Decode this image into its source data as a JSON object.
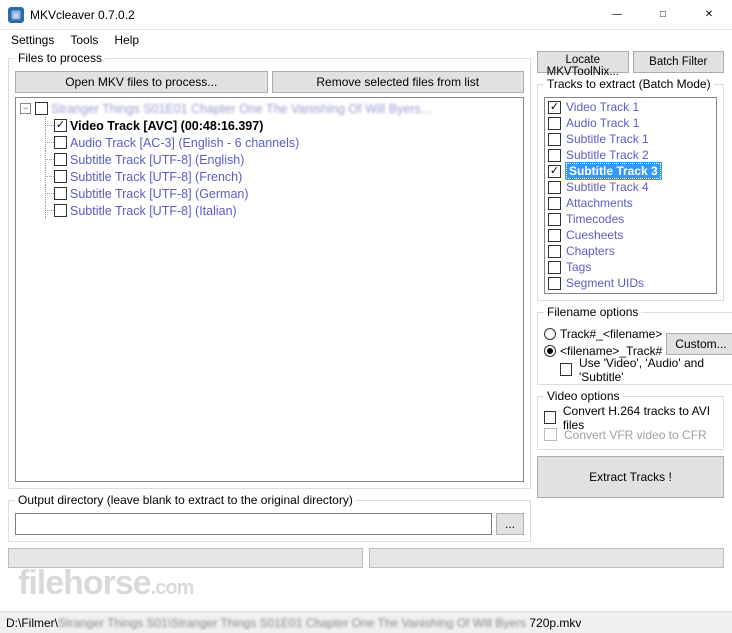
{
  "window": {
    "title": "MKVcleaver 0.7.0.2"
  },
  "menu": {
    "settings": "Settings",
    "tools": "Tools",
    "help": "Help"
  },
  "files_group": {
    "legend": "Files to process",
    "open_btn": "Open MKV files to process...",
    "remove_btn": "Remove selected files from list"
  },
  "tree": {
    "file_title_obscured": "Stranger Things S01E01 Chapter One The Vanishing Of Will Byers...",
    "tracks": [
      {
        "label": "Video Track [AVC] (00:48:16.397)",
        "checked": true,
        "bold": true
      },
      {
        "label": "Audio Track [AC-3] (English - 6 channels)",
        "checked": false,
        "bold": false
      },
      {
        "label": "Subtitle Track [UTF-8] (English)",
        "checked": false,
        "bold": false
      },
      {
        "label": "Subtitle Track [UTF-8] (French)",
        "checked": false,
        "bold": false
      },
      {
        "label": "Subtitle Track [UTF-8] (German)",
        "checked": false,
        "bold": false
      },
      {
        "label": "Subtitle Track [UTF-8] (Italian)",
        "checked": false,
        "bold": false
      }
    ]
  },
  "output_group": {
    "legend": "Output directory (leave blank to extract to the original directory)",
    "value": "",
    "browse": "..."
  },
  "right_top": {
    "locate": "Locate MKVToolNix...",
    "batch_filter": "Batch Filter"
  },
  "tracks_extract": {
    "legend": "Tracks to extract (Batch Mode)",
    "items": [
      {
        "label": "Video Track 1",
        "checked": true,
        "selected": false
      },
      {
        "label": "Audio Track 1",
        "checked": false,
        "selected": false
      },
      {
        "label": "Subtitle Track 1",
        "checked": false,
        "selected": false
      },
      {
        "label": "Subtitle Track 2",
        "checked": false,
        "selected": false
      },
      {
        "label": "Subtitle Track 3",
        "checked": true,
        "selected": true
      },
      {
        "label": "Subtitle Track 4",
        "checked": false,
        "selected": false
      },
      {
        "label": "Attachments",
        "checked": false,
        "selected": false
      },
      {
        "label": "Timecodes",
        "checked": false,
        "selected": false
      },
      {
        "label": "Cuesheets",
        "checked": false,
        "selected": false
      },
      {
        "label": "Chapters",
        "checked": false,
        "selected": false
      },
      {
        "label": "Tags",
        "checked": false,
        "selected": false
      },
      {
        "label": "Segment UIDs",
        "checked": false,
        "selected": false
      }
    ]
  },
  "filename_opts": {
    "legend": "Filename options",
    "opt1": "Track#_<filename>",
    "opt2": "<filename>_Track#",
    "custom_btn": "Custom...",
    "use_names": "Use 'Video', 'Audio' and 'Subtitle'"
  },
  "video_opts": {
    "legend": "Video options",
    "h264": "Convert H.264 tracks to AVI files",
    "vfr": "Convert VFR video to CFR"
  },
  "extract_btn": "Extract Tracks !",
  "status": {
    "prefix": "D:\\Filmer\\",
    "blur": "Stranger Things S01\\Stranger Things S01E01 Chapter One The Vanishing Of Will Byers ",
    "suffix": "720p.mkv"
  },
  "watermark": "filehorse",
  "watermark_dotcom": ".com"
}
